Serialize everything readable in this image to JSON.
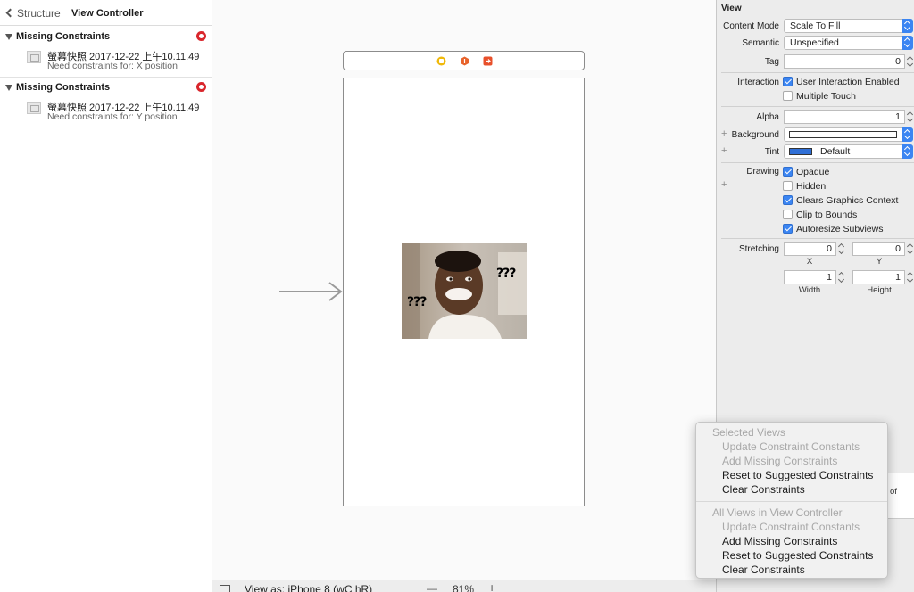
{
  "left_panel": {
    "breadcrumb": {
      "back": "Structure",
      "title": "View Controller"
    },
    "groups": [
      {
        "title": "Missing Constraints",
        "issue_title": "螢幕快照 2017-12-22 上午10.11.49",
        "issue_detail": "Need constraints for: X position"
      },
      {
        "title": "Missing Constraints",
        "issue_title": "螢幕快照 2017-12-22 上午10.11.49",
        "issue_detail": "Need constraints for: Y position"
      }
    ]
  },
  "canvas": {
    "image_marks": {
      "left": "???",
      "right": "???"
    },
    "bottom_bar": {
      "view_as": "View as: iPhone 8 (wC hR)",
      "zoom": "81%",
      "minus": "—",
      "plus": "+"
    }
  },
  "inspector": {
    "section": "View",
    "content_mode": {
      "label": "Content Mode",
      "value": "Scale To Fill"
    },
    "semantic": {
      "label": "Semantic",
      "value": "Unspecified"
    },
    "tag": {
      "label": "Tag",
      "value": "0"
    },
    "interaction": {
      "label": "Interaction",
      "user_interaction": "User Interaction Enabled",
      "multiple_touch": "Multiple Touch"
    },
    "alpha": {
      "label": "Alpha",
      "value": "1"
    },
    "background": {
      "label": "Background"
    },
    "tint": {
      "label": "Tint",
      "value": "Default",
      "swatch": "#2f6fd6"
    },
    "drawing": {
      "label": "Drawing",
      "opaque": "Opaque",
      "hidden": "Hidden",
      "clears": "Clears Graphics Context",
      "clip": "Clip to Bounds",
      "autoresize": "Autoresize Subviews"
    },
    "stretching": {
      "label": "Stretching",
      "x": "0",
      "y": "0",
      "x_label": "X",
      "y_label": "Y",
      "width": "1",
      "height": "1",
      "width_label": "Width",
      "height_label": "Height"
    },
    "peek_text": "of"
  },
  "menu": {
    "selected_header": "Selected Views",
    "selected_items": [
      "Update Constraint Constants",
      "Add Missing Constraints",
      "Reset to Suggested Constraints",
      "Clear Constraints"
    ],
    "all_header": "All Views in View Controller",
    "all_items": [
      "Update Constraint Constants",
      "Add Missing Constraints",
      "Reset to Suggested Constraints",
      "Clear Constraints"
    ]
  },
  "colors": {
    "accent": "#3b85f2",
    "error": "#d9262c"
  }
}
